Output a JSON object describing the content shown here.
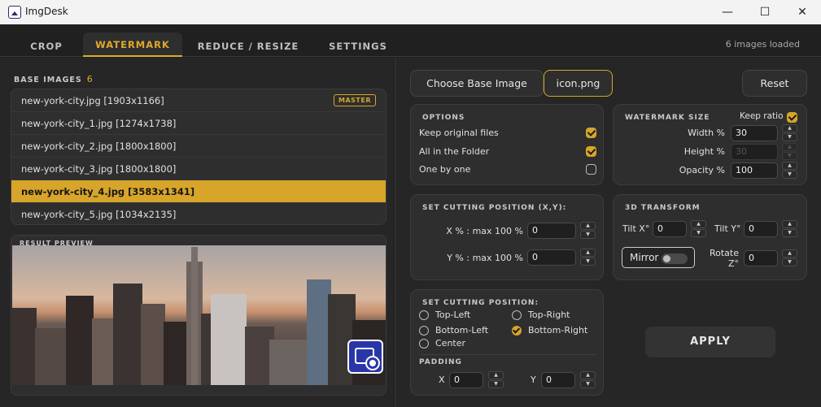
{
  "window": {
    "title": "ImgDesk"
  },
  "tabs": [
    {
      "label": "CROP"
    },
    {
      "label": "WATERMARK"
    },
    {
      "label": "REDUCE / RESIZE"
    },
    {
      "label": "SETTINGS"
    }
  ],
  "status": {
    "loaded": "6 images loaded"
  },
  "base_images": {
    "label": "BASE IMAGES",
    "count": "6",
    "master_badge": "MASTER",
    "items": [
      {
        "name": "new-york-city.jpg [1903x1166]"
      },
      {
        "name": "new-york-city_1.jpg [1274x1738]"
      },
      {
        "name": "new-york-city_2.jpg [1800x1800]"
      },
      {
        "name": "new-york-city_3.jpg [1800x1800]"
      },
      {
        "name": "new-york-city_4.jpg [3583x1341]"
      },
      {
        "name": "new-york-city_5.jpg [1034x2135]"
      }
    ],
    "selected_index": 4
  },
  "preview": {
    "label": "RESULT PREVIEW"
  },
  "toolbar": {
    "choose_label": "Choose Base Image",
    "file_label": "icon.png",
    "reset_label": "Reset"
  },
  "options": {
    "label": "OPTIONS",
    "keep_original": "Keep original files",
    "all_folder": "All in the Folder",
    "one_by_one": "One by one"
  },
  "wm_size": {
    "label": "WATERMARK SIZE",
    "keep_ratio": "Keep ratio",
    "width_label": "Width %",
    "width_value": "30",
    "height_label": "Height %",
    "height_value": "30",
    "opacity_label": "Opacity %",
    "opacity_value": "100"
  },
  "cut_xy": {
    "label": "SET CUTTING POSITION (X,Y):",
    "x_label": "X % : max 100 %",
    "x_value": "0",
    "y_label": "Y % : max 100 %",
    "y_value": "0"
  },
  "transform": {
    "label": "3D TRANSFORM",
    "tilt_x_label": "Tilt X°",
    "tilt_x_value": "0",
    "tilt_y_label": "Tilt Y°",
    "tilt_y_value": "0",
    "mirror_label": "Mirror",
    "rotate_label_1": "Rotate",
    "rotate_label_2": "Z°",
    "rotate_value": "0"
  },
  "cut_pos": {
    "label": "SET CUTTING POSITION:",
    "top_left": "Top-Left",
    "top_right": "Top-Right",
    "bottom_left": "Bottom-Left",
    "bottom_right": "Bottom-Right",
    "center": "Center",
    "padding_label": "PADDING",
    "pad_x_label": "X",
    "pad_x_value": "0",
    "pad_y_label": "Y",
    "pad_y_value": "0"
  },
  "apply_label": "APPLY",
  "colors": {
    "accent": "#d7a52a",
    "background": "#202020",
    "panel": "#2e2e2e"
  }
}
